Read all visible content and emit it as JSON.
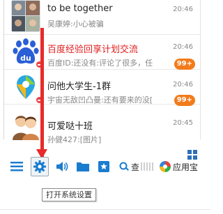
{
  "chats": [
    {
      "title": "to be together",
      "subtitle": "吴康婷:小心被骗",
      "time": "20:46",
      "badge": ""
    },
    {
      "title": "百度经验回享计划交流",
      "subtitle": "百度ID:还没有:评论了很多，任",
      "time": "20:46",
      "badge": "99+"
    },
    {
      "title": "问他大学生-1群",
      "subtitle": "宇宙无敌凹凸曼:还有要来的没[",
      "time": "20:46",
      "badge": "99+"
    },
    {
      "title": "可爱哒十班",
      "subtitle": "孙健427:[图片]",
      "time": "20:45",
      "badge": ""
    }
  ],
  "toolbar": {
    "partial_text": "查",
    "app_store_label": "应用宝"
  },
  "tooltip": "打开系统设置",
  "colors": {
    "accent_blue": "#1a7ccf",
    "badge_orange": "#f27b1b",
    "red_title": "#e02020",
    "arrow_red": "#e82a2a"
  }
}
